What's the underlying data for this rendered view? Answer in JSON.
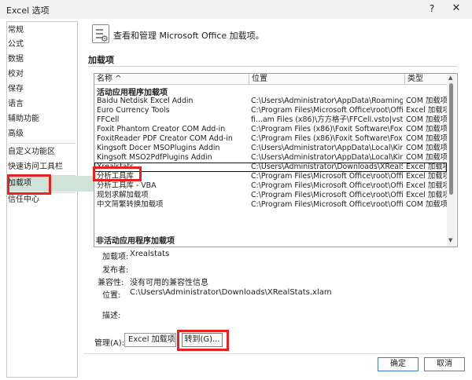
{
  "window": {
    "title": "Excel 选项",
    "help_symbol": "?",
    "close_symbol": "✕"
  },
  "nav": {
    "items": [
      {
        "label": "常规"
      },
      {
        "label": "公式"
      },
      {
        "label": "数据"
      },
      {
        "label": "校对"
      },
      {
        "label": "保存"
      },
      {
        "label": "语言"
      },
      {
        "label": "辅助功能"
      },
      {
        "label": "高级"
      },
      {
        "label": "自定义功能区"
      },
      {
        "label": "快速访问工具栏"
      },
      {
        "label": "加载项"
      },
      {
        "label": "信任中心"
      }
    ],
    "selected": "加载项"
  },
  "header": {
    "text": "查看和管理 Microsoft Office 加载项。"
  },
  "addins": {
    "section_title": "加载项",
    "columns": {
      "name": "名称 ^",
      "location": "位置",
      "type": "类型"
    },
    "active_group": "活动应用程序加载项",
    "active": [
      {
        "name": "Baidu Netdisk Excel Addin",
        "location": "C:\\Users\\Administrator\\AppData\\Roaming\\ba",
        "type": "COM 加载项"
      },
      {
        "name": "Euro Currency Tools",
        "location": "C:\\Program Files\\Microsoft Office\\root\\Office",
        "type": "Excel 加载项"
      },
      {
        "name": "FFCell",
        "location": "fi...am Files (x86)\\方方格子\\FFCell.vsto|vstoloca",
        "type": "COM 加载项"
      },
      {
        "name": "Foxit Phantom Creator COM Add-in",
        "location": "C:\\Program Files (x86)\\Foxit Software\\Foxit Ph",
        "type": "COM 加载项"
      },
      {
        "name": "FoxitReader PDF Creator COM Add-in",
        "location": "C:\\Program Files (x86)\\Foxit Software\\Foxit P",
        "type": "COM 加载项"
      },
      {
        "name": "Kingsoft Docer MSOPlugins Addin",
        "location": "C:\\Users\\Administrator\\AppData\\Local\\Kings",
        "type": "COM 加载项"
      },
      {
        "name": "Kingsoft MSO2PdfPlugins Addin",
        "location": "C:\\Users\\Administrator\\AppData\\Local\\Kings",
        "type": "COM 加载项"
      },
      {
        "name": "Xrealstats",
        "location": "C:\\Users\\Administrator\\Downloads\\XRealStat",
        "type": "Excel 加载项"
      },
      {
        "name": "分析工具库",
        "location": "C:\\Program Files\\Microsoft Office\\root\\Office",
        "type": "Excel 加载项"
      },
      {
        "name": "分析工具库 - VBA",
        "location": "C:\\Program Files\\Microsoft Office\\root\\Office",
        "type": "Excel 加载项"
      },
      {
        "name": "规划求解加载项",
        "location": "C:\\Program Files\\Microsoft Office\\root\\Office",
        "type": "Excel 加载项"
      },
      {
        "name": "中文简繁转换加载项",
        "location": "C:\\Program Files\\Microsoft Office\\root\\Office",
        "type": "COM 加载项"
      }
    ],
    "selected_index": 7,
    "inactive_group": "非活动应用程序加载项"
  },
  "details": {
    "addin_label": "加载项:",
    "addin_value": "Xrealstats",
    "publisher_label": "发布者:",
    "publisher_value": "",
    "compat_label": "兼容性:",
    "compat_value": "没有可用的兼容性信息",
    "location_label": "位置:",
    "location_value": "C:\\Users\\Administrator\\Downloads\\XRealStats.xlam",
    "desc_label": "描述:",
    "desc_value": ""
  },
  "manage": {
    "label": "管理(A):",
    "selected": "Excel 加载项",
    "go_label": "转到(G)..."
  },
  "buttons": {
    "ok": "确定",
    "cancel": "取消"
  },
  "colors": {
    "highlight": "#e8231f",
    "nav_selected": "#cfe3d8"
  }
}
